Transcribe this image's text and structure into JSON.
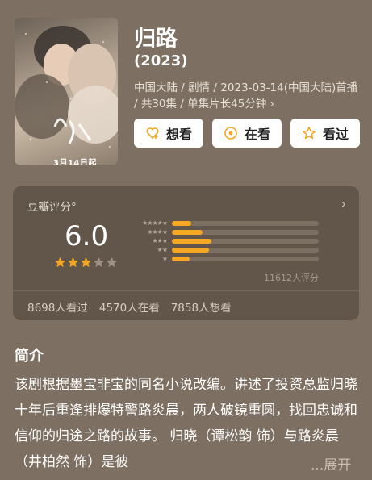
{
  "show": {
    "title": "归路",
    "year": "(2023)",
    "meta": "中国大陆 / 剧情 / 2023-03-14(中国大陆)首播 / 共30集 / 单集片长45分钟 ›",
    "poster_title": "归路",
    "poster_date": "3月14日起"
  },
  "actions": [
    {
      "label": "想看",
      "icon": "heart-plus-icon"
    },
    {
      "label": "在看",
      "icon": "target-circle-icon"
    },
    {
      "label": "看过",
      "icon": "star-outline-icon"
    }
  ],
  "rating": {
    "label": "豆瓣评分°",
    "score": "6.0",
    "stars_filled": 3,
    "stars_total": 5,
    "distribution": [
      {
        "stars": "★★★★★",
        "fraction": 0.13
      },
      {
        "stars": "★★★★",
        "fraction": 0.21
      },
      {
        "stars": "★★★",
        "fraction": 0.27
      },
      {
        "stars": "★★",
        "fraction": 0.25
      },
      {
        "stars": "★",
        "fraction": 0.12
      }
    ],
    "count": "11612人评分",
    "wish": "8698人看过",
    "watching": "4570人在看",
    "collect": "7858人想看",
    "accent": "#f5a623"
  },
  "synopsis": {
    "heading": "简介",
    "text": "该剧根据墨宝非宝的同名小说改编。讲述了投资总监归晓十年后重逢排爆特警路炎晨，两人破镜重圆，找回忠诚和信仰的归途之路的故事。 归晓（谭松韵 饰）与路炎晨（井柏然 饰）是彼",
    "more": "...展开"
  }
}
